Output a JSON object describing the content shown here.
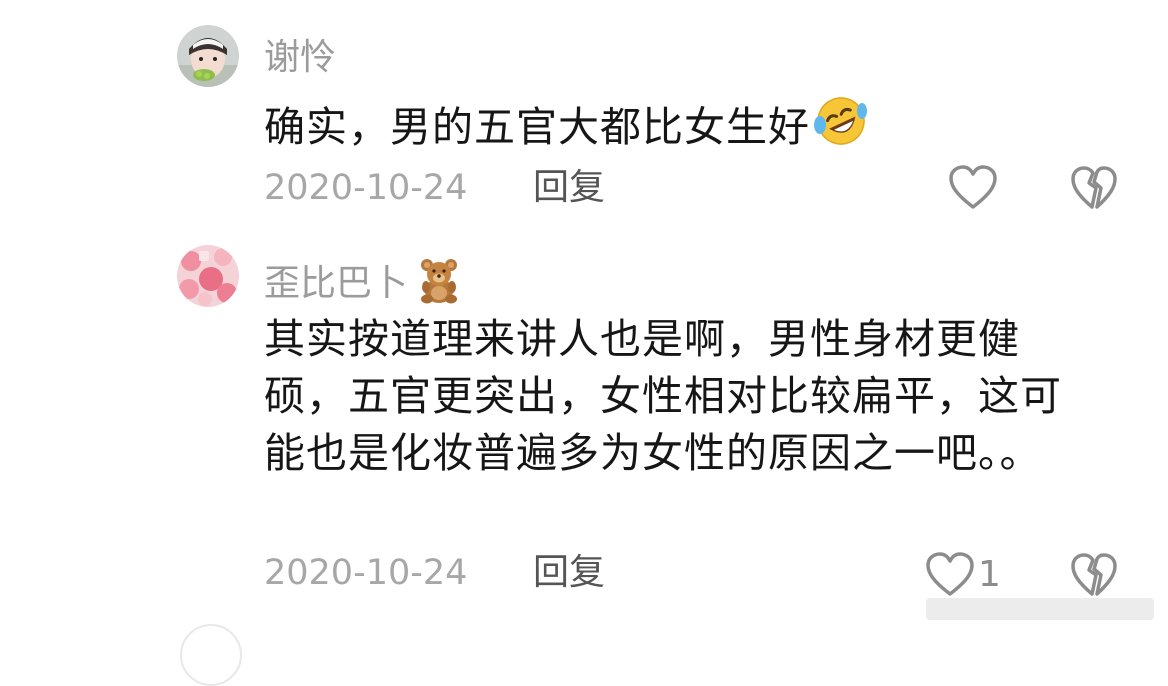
{
  "comments": [
    {
      "username": "谢怜",
      "text": "确实，男的五官大都比女生好",
      "emoji": "rolling-on-floor-laughing-emoji",
      "date": "2020-10-24",
      "reply_label": "回复",
      "like_count": ""
    },
    {
      "username": "歪比巴卜",
      "username_emoji": "teddy-bear-emoji",
      "text": "其实按道理来讲人也是啊，男性身材更健硕，五官更突出，女性相对比较扁平，这可能也是化妆普遍多为女性的原因之一吧。。",
      "date": "2020-10-24",
      "reply_label": "回复",
      "like_count": "1"
    }
  ],
  "icons": {
    "like": "heart-outline-icon",
    "dislike": "broken-heart-icon"
  },
  "colors": {
    "username": "#9b9b9b",
    "text": "#161616",
    "meta": "#a7a7a7",
    "icon": "#8c8c8c"
  }
}
